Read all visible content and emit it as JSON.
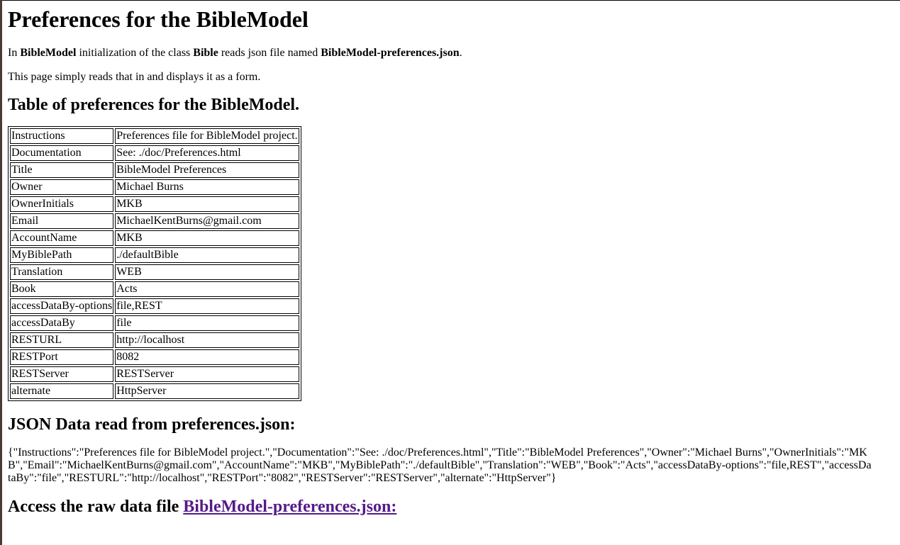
{
  "page": {
    "title": "Preferences for the BibleModel",
    "intro": {
      "t1": "In ",
      "b1": "BibleModel",
      "t2": " initialization of the class ",
      "b2": "Bible",
      "t3": " reads json file named ",
      "b3": "BibleModel-preferences.json",
      "t4": "."
    },
    "intro2": "This page simply reads that in and displays it as a form.",
    "table_heading": "Table of preferences for the BibleModel.",
    "json_heading": "JSON Data read from preferences.json:",
    "json_text": "{\"Instructions\":\"Preferences file for BibleModel project.\",\"Documentation\":\"See: ./doc/Preferences.html\",\"Title\":\"BibleModel Preferences\",\"Owner\":\"Michael Burns\",\"OwnerInitials\":\"MKB\",\"Email\":\"MichaelKentBurns@gmail.com\",\"AccountName\":\"MKB\",\"MyBiblePath\":\"./defaultBible\",\"Translation\":\"WEB\",\"Book\":\"Acts\",\"accessDataBy-options\":\"file,REST\",\"accessDataBy\":\"file\",\"RESTURL\":\"http://localhost\",\"RESTPort\":\"8082\",\"RESTServer\":\"RESTServer\",\"alternate\":\"HttpServer\"}",
    "raw_heading_text": "Access the raw data file ",
    "raw_link_text": "BibleModel-preferences.json:"
  },
  "prefs": [
    {
      "key": "Instructions",
      "value": "Preferences file for BibleModel project."
    },
    {
      "key": "Documentation",
      "value": "See: ./doc/Preferences.html"
    },
    {
      "key": "Title",
      "value": "BibleModel Preferences"
    },
    {
      "key": "Owner",
      "value": "Michael Burns"
    },
    {
      "key": "OwnerInitials",
      "value": "MKB"
    },
    {
      "key": "Email",
      "value": "MichaelKentBurns@gmail.com"
    },
    {
      "key": "AccountName",
      "value": "MKB"
    },
    {
      "key": "MyBiblePath",
      "value": "./defaultBible"
    },
    {
      "key": "Translation",
      "value": "WEB"
    },
    {
      "key": "Book",
      "value": "Acts"
    },
    {
      "key": "accessDataBy-options",
      "value": "file,REST"
    },
    {
      "key": "accessDataBy",
      "value": "file"
    },
    {
      "key": "RESTURL",
      "value": "http://localhost"
    },
    {
      "key": "RESTPort",
      "value": "8082"
    },
    {
      "key": "RESTServer",
      "value": "RESTServer"
    },
    {
      "key": "alternate",
      "value": "HttpServer"
    }
  ]
}
